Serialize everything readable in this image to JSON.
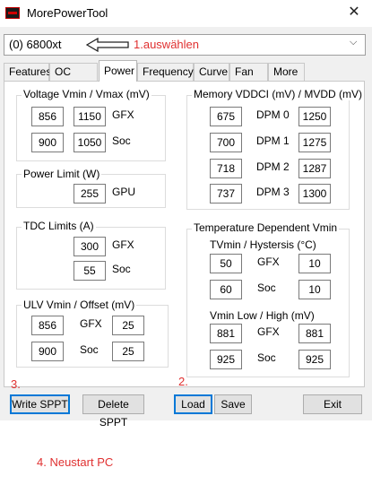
{
  "window": {
    "title": "MorePowerTool",
    "close_glyph": "✕"
  },
  "card_select": {
    "value": "(0) 6800xt"
  },
  "annotations": {
    "step1": "1.auswählen",
    "step2": "2.",
    "step3": "3.",
    "step4": "4. Neustart PC"
  },
  "tabs": [
    "Features",
    "OC Limits",
    "Power",
    "Frequency",
    "Curve",
    "Fan",
    "More"
  ],
  "active_tab": "Power",
  "voltage": {
    "title": "Voltage Vmin / Vmax (mV)",
    "gfx_label": "GFX",
    "soc_label": "Soc",
    "gfx_min": "856",
    "gfx_max": "1150",
    "soc_min": "900",
    "soc_max": "1050"
  },
  "power_limit": {
    "title": "Power Limit (W)",
    "label": "GPU",
    "value": "255"
  },
  "tdc": {
    "title": "TDC Limits (A)",
    "gfx_label": "GFX",
    "gfx": "300",
    "soc_label": "Soc",
    "soc": "55"
  },
  "ulv": {
    "title": "ULV Vmin / Offset (mV)",
    "gfx_label": "GFX",
    "soc_label": "Soc",
    "gfx_vmin": "856",
    "gfx_offset": "25",
    "soc_vmin": "900",
    "soc_offset": "25"
  },
  "memory": {
    "title": "Memory VDDCI (mV) / MVDD (mV)",
    "rows": [
      {
        "label": "DPM 0",
        "vddci": "675",
        "mvdd": "1250"
      },
      {
        "label": "DPM 1",
        "vddci": "700",
        "mvdd": "1275"
      },
      {
        "label": "DPM 2",
        "vddci": "718",
        "mvdd": "1287"
      },
      {
        "label": "DPM 3",
        "vddci": "737",
        "mvdd": "1300"
      }
    ]
  },
  "temp": {
    "title": "Temperature Dependent Vmin",
    "tvmin_title": "TVmin / Hystersis (°C)",
    "gfx_label": "GFX",
    "soc_label": "Soc",
    "tvmin_gfx": "50",
    "hyst_gfx": "10",
    "tvmin_soc": "60",
    "hyst_soc": "10",
    "vmin_title": "Vmin Low / High (mV)",
    "low_gfx": "881",
    "high_gfx": "881",
    "low_soc": "925",
    "high_soc": "925"
  },
  "buttons": {
    "write_sppt": "Write SPPT",
    "delete_sppt": "Delete SPPT",
    "load": "Load",
    "save": "Save",
    "exit": "Exit"
  },
  "colors": {
    "annotation": "#e03030",
    "focus_border": "#0078d7"
  }
}
